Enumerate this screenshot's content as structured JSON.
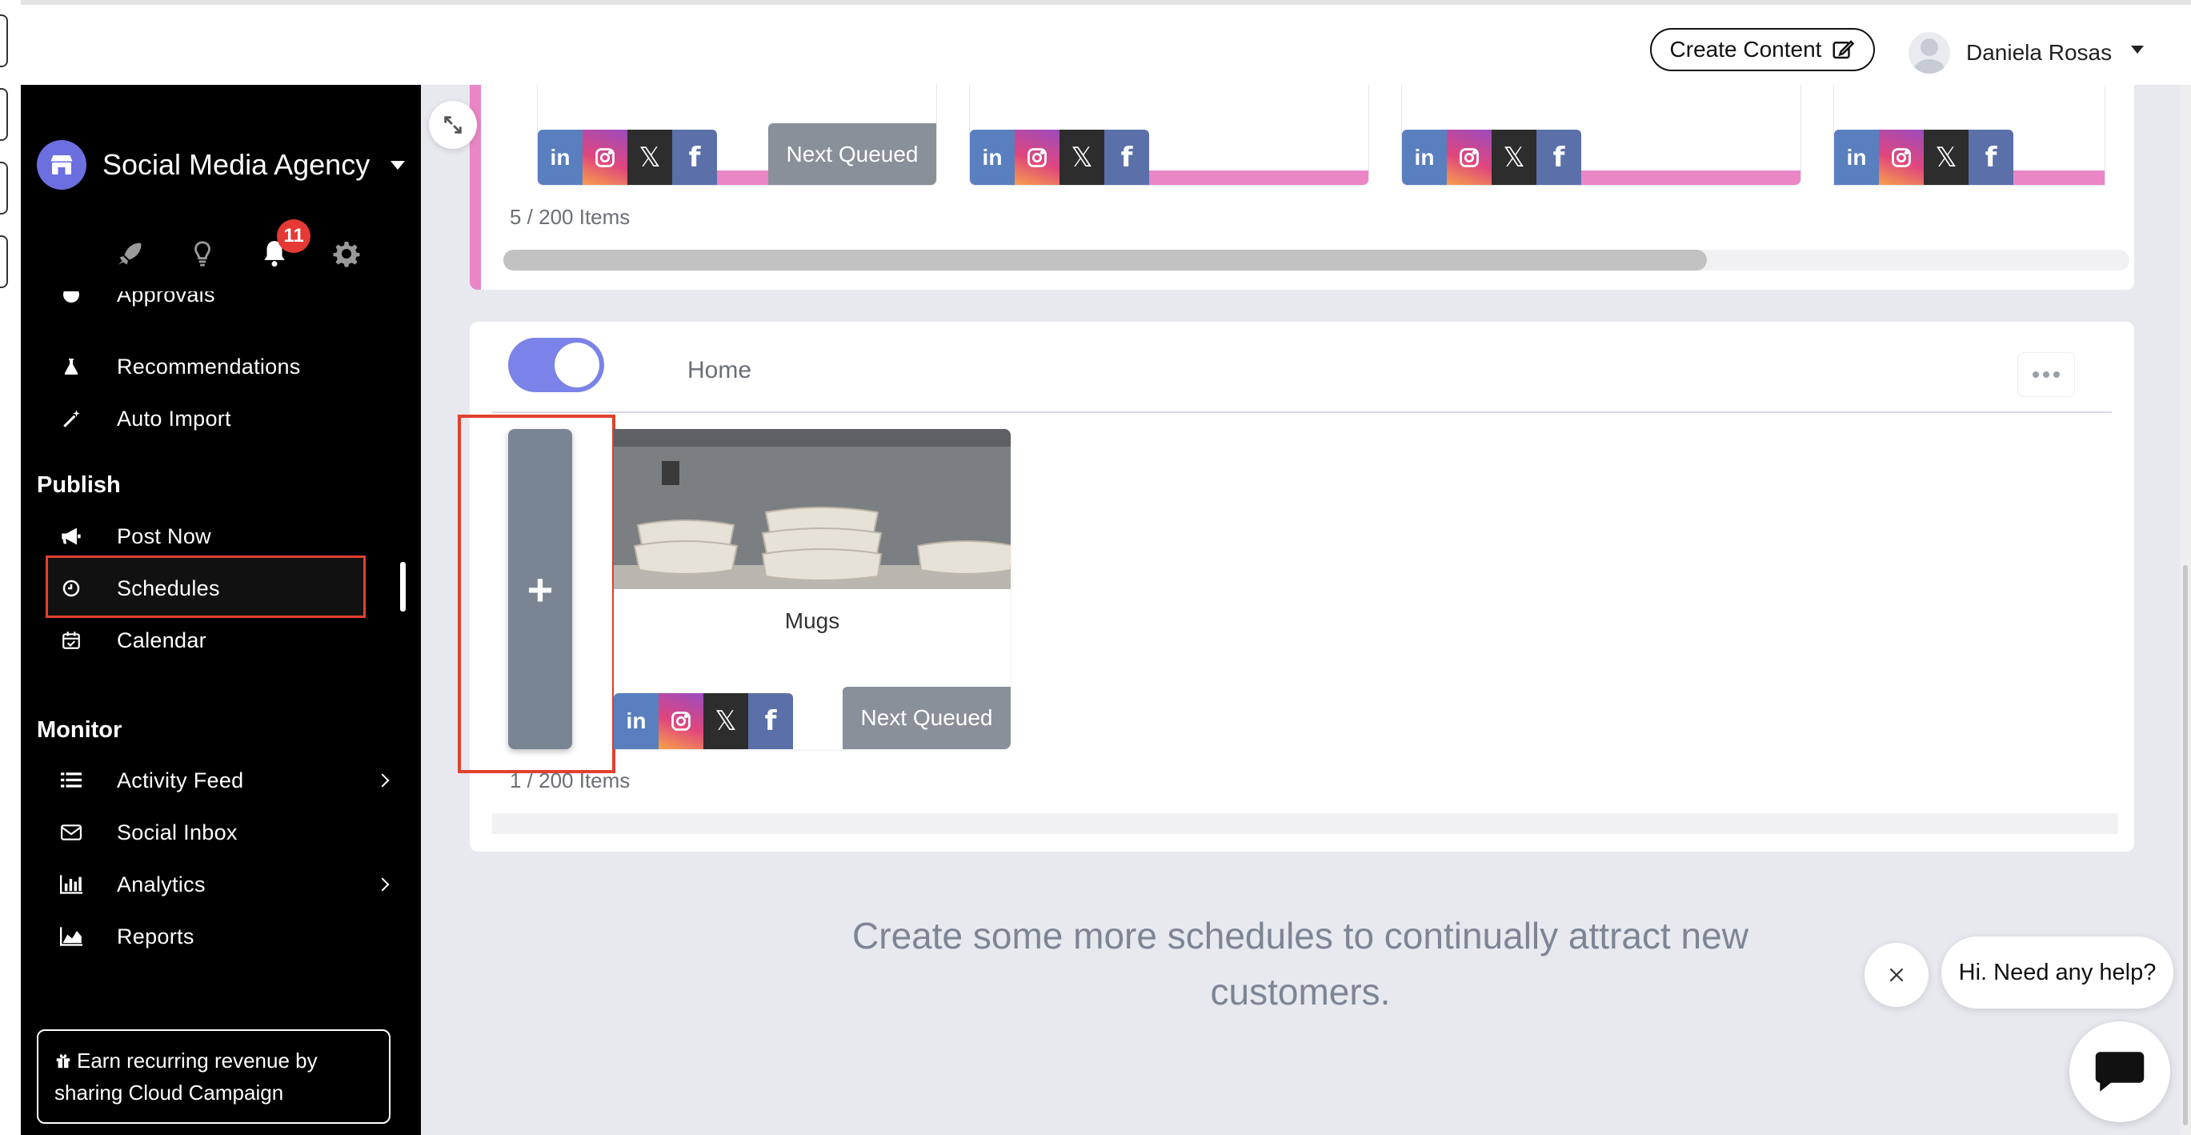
{
  "header": {
    "create_content_label": "Create Content",
    "user_name": "Daniela Rosas"
  },
  "sidebar": {
    "agency_name": "Social Media Agency",
    "notification_count": "11",
    "items_top": [
      {
        "label": "Approvals",
        "icon": "check-icon"
      },
      {
        "label": "Recommendations",
        "icon": "flask-icon"
      },
      {
        "label": "Auto Import",
        "icon": "magic-wand-icon"
      }
    ],
    "publish_title": "Publish",
    "publish_items": [
      {
        "label": "Post Now",
        "icon": "megaphone-icon"
      },
      {
        "label": "Schedules",
        "icon": "clock-icon",
        "active": true
      },
      {
        "label": "Calendar",
        "icon": "calendar-check-icon"
      }
    ],
    "monitor_title": "Monitor",
    "monitor_items": [
      {
        "label": "Activity Feed",
        "icon": "list-icon",
        "has_submenu": true
      },
      {
        "label": "Social Inbox",
        "icon": "envelope-icon"
      },
      {
        "label": "Analytics",
        "icon": "bar-chart-icon",
        "has_submenu": true
      },
      {
        "label": "Reports",
        "icon": "area-chart-icon"
      }
    ],
    "earn_text": "Earn recurring revenue by sharing Cloud Campaign"
  },
  "schedule_top": {
    "next_queued_label": "Next Queued",
    "items_count": "5 / 200 Items",
    "scroll_fraction": 0.74
  },
  "schedule_home": {
    "name": "Home",
    "enabled": true,
    "add_label": "+",
    "post_title": "Mugs",
    "next_queued_label": "Next Queued",
    "items_count": "1 / 200 Items"
  },
  "social_networks": [
    "in",
    "instagram",
    "𝕏",
    "f"
  ],
  "empty_message": "Create some more schedules to continually attract new customers.",
  "chat": {
    "bubble_text": "Hi. Need any help?"
  },
  "colors": {
    "accent_pink": "#ea86c6",
    "toggle_on": "#7b83e8",
    "highlight_red": "#e2412d",
    "notification_red": "#e53935"
  }
}
